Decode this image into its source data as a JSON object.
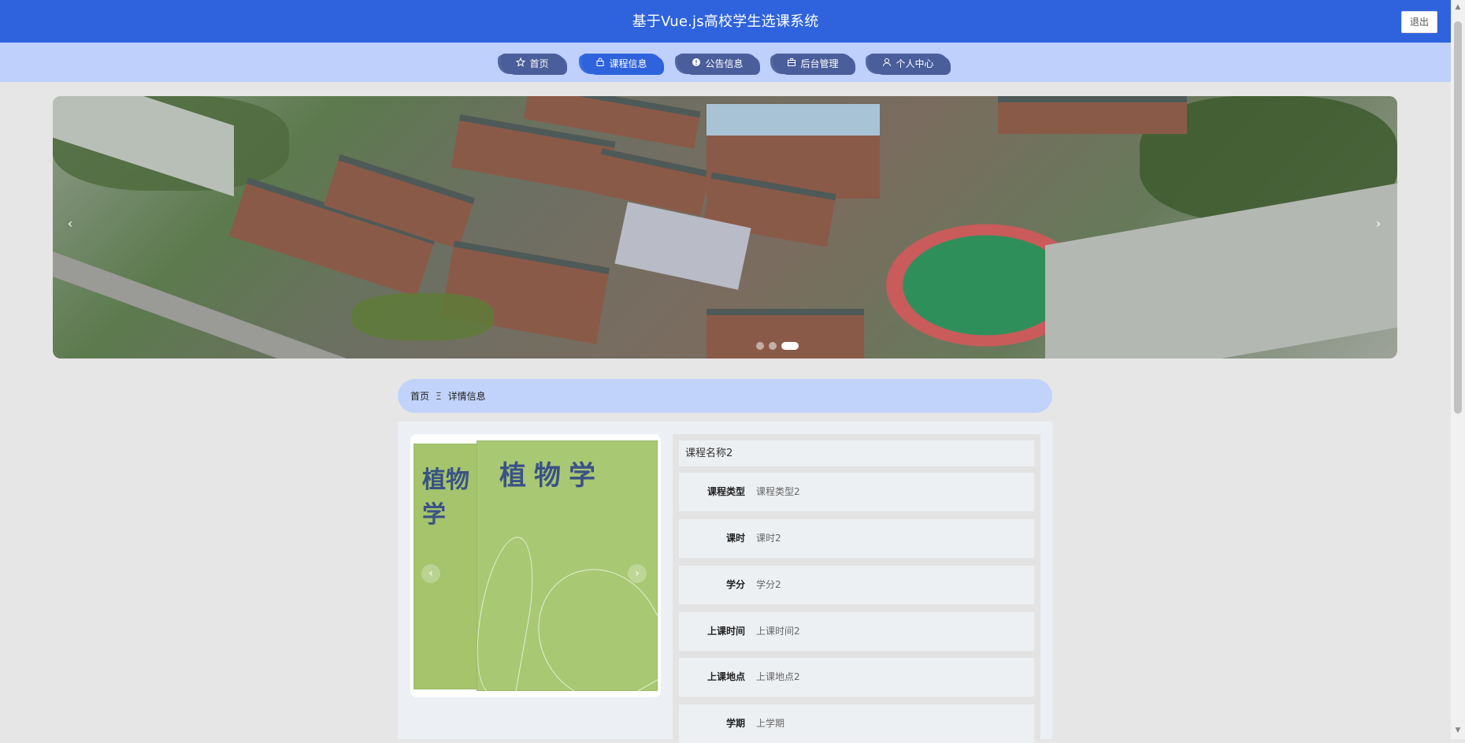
{
  "header": {
    "title": "基于Vue.js高校学生选课系统",
    "logout_label": "退出"
  },
  "nav": {
    "items": [
      {
        "label": "首页",
        "icon": "star-icon"
      },
      {
        "label": "课程信息",
        "icon": "bag-icon"
      },
      {
        "label": "公告信息",
        "icon": "info-circle-icon"
      },
      {
        "label": "后台管理",
        "icon": "briefcase-icon"
      },
      {
        "label": "个人中心",
        "icon": "user-icon"
      }
    ],
    "active_index": 1
  },
  "banner": {
    "prev": "‹",
    "next": "›",
    "slide_count": 3,
    "active_slide": 3
  },
  "breadcrumb": {
    "home": "首页",
    "separator": "Ξ",
    "current": "详情信息"
  },
  "course": {
    "name": "课程名称2",
    "image": {
      "book_title": "植物学",
      "prev": "‹",
      "next": "›"
    },
    "fields": [
      {
        "label": "课程类型",
        "value": "课程类型2"
      },
      {
        "label": "课时",
        "value": "课时2"
      },
      {
        "label": "学分",
        "value": "学分2"
      },
      {
        "label": "上课时间",
        "value": "上课时间2"
      },
      {
        "label": "上课地点",
        "value": "上课地点2"
      },
      {
        "label": "学期",
        "value": "上学期"
      }
    ]
  },
  "colors": {
    "header": "#2e63dd",
    "nav_bg": "#bed0fb",
    "nav_item": "#4a5e9c",
    "page_bg": "#e6e6e6"
  }
}
